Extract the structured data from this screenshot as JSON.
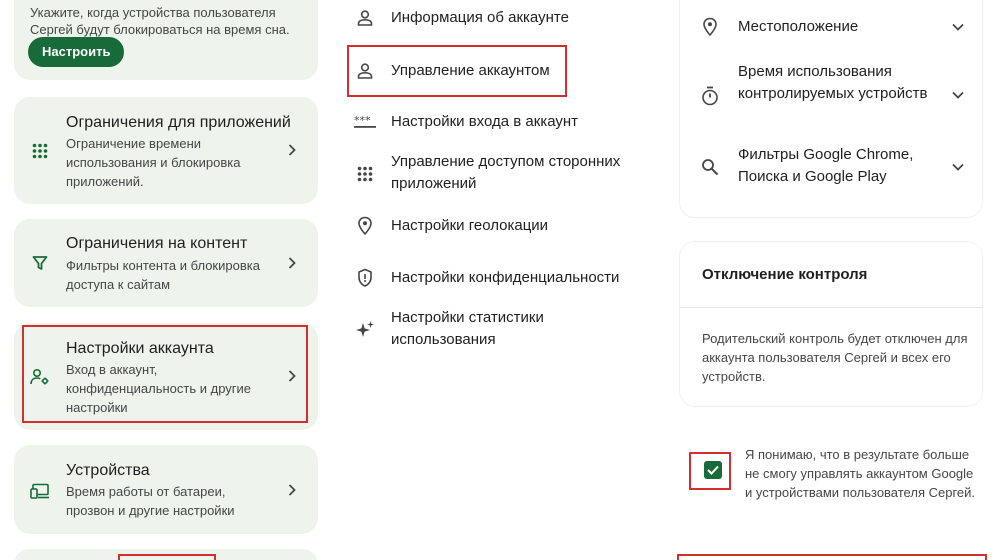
{
  "left": {
    "top_card": {
      "desc_line1": "Укажите, когда устройства пользователя",
      "desc_line2": "Сергей будут блокироваться на время сна.",
      "button": "Настроить"
    },
    "cards": [
      {
        "title": "Ограничения для приложений",
        "sub": "Ограничение времени использования и блокировка приложений.",
        "icon": "apps-grid-icon"
      },
      {
        "title": "Ограничения на контент",
        "sub": "Фильтры контента и блокировка доступа к сайтам",
        "icon": "filter-icon"
      },
      {
        "title": "Настройки аккаунта",
        "sub": "Вход в аккаунт, конфиденциальность и другие настройки",
        "icon": "account-settings-icon"
      },
      {
        "title": "Устройства",
        "sub": "Время работы от батареи, прозвон и другие настройки",
        "icon": "devices-icon"
      }
    ]
  },
  "middle": {
    "items": [
      {
        "label": "Информация об аккаунте",
        "icon": "person-icon"
      },
      {
        "label": "Управление аккаунтом",
        "icon": "person-icon"
      },
      {
        "label": "Настройки входа в аккаунт",
        "icon": "password-icon"
      },
      {
        "label": "Управление доступом сторонних приложений",
        "icon": "apps-grid-icon"
      },
      {
        "label": "Настройки геолокации",
        "icon": "location-pin-icon"
      },
      {
        "label": "Настройки конфиденциальности",
        "icon": "shield-icon"
      },
      {
        "label": "Настройки статистики использования",
        "icon": "sparkle-icon"
      }
    ]
  },
  "right": {
    "items": [
      {
        "label": "Местоположение",
        "icon": "location-pin-icon"
      },
      {
        "label": "Время использования контролируемых устройств",
        "icon": "timer-icon"
      },
      {
        "label": "Фильтры Google Chrome, Поиска и Google Play",
        "icon": "search-icon"
      }
    ],
    "disable": {
      "title": "Отключение контроля",
      "text": "Родительский контроль будет отключен для аккаунта пользователя Сергей и всех его устройств."
    },
    "ack": {
      "checked": true,
      "text": "Я понимаю, что в результате больше не смогу управлять аккаунтом Google и устройствами пользователя Сергей."
    }
  },
  "colors": {
    "accent": "#176b38",
    "highlight": "#d32f2f",
    "card_bg": "#eef3ec"
  }
}
